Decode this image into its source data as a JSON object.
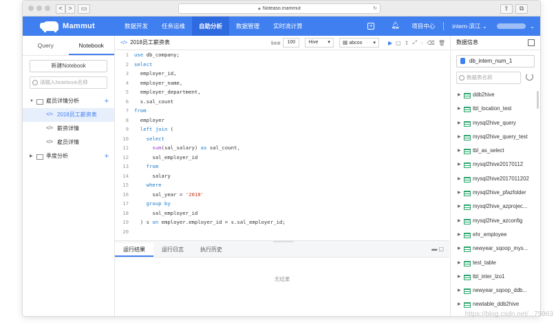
{
  "browser": {
    "url": "Noteaso.mammut",
    "back": "<",
    "forward": ">"
  },
  "app": {
    "logo_text": "Mammut",
    "menu": [
      "数据开发",
      "任务运维",
      "自助分析",
      "数据管理",
      "实时流计算"
    ],
    "active_menu": 2,
    "project_center": "项目中心",
    "project": "intern-滨江",
    "colors": {
      "nav": "#3f7ff0",
      "accent": "#3f7ff0"
    }
  },
  "left": {
    "tabs": [
      "Query",
      "Notebook"
    ],
    "new_notebook": "新建Notebook",
    "search_placeholder": "请输入Notebook名称",
    "tree": {
      "folder1": "雇员详情分析",
      "file1": "2018员工薪资表",
      "file2": "薪资详情",
      "file3": "雇员详情",
      "folder2": "季度分析"
    }
  },
  "editor": {
    "title": "2018员工薪资表",
    "limit_label": "limit",
    "limit_value": "100",
    "engine": "Hive",
    "queue": "abcoo",
    "lines": [
      "use db_company;",
      "select",
      "  employer_id,",
      "  employer_name,",
      "  employer_department,",
      "  s.sal_count",
      "from",
      "  employer",
      "  left join (",
      "    select",
      "      sum(sal_salary) as sal_count,",
      "      sal_employer_id",
      "    from",
      "      salary",
      "    where",
      "      sal_year = '2018'",
      "    group by",
      "      sal_employer_id",
      "  ) s on employer.employer_id = s.sal_employer_id;",
      ""
    ],
    "result_tabs": [
      "运行结果",
      "运行日志",
      "执行历史"
    ],
    "no_result": "无结果"
  },
  "right": {
    "title": "数据信息",
    "database": "db_intern_num_1",
    "search_placeholder": "数据表名称",
    "tables": [
      "ddb2hive",
      "tbl_location_test",
      "mysql2hive_query",
      "mysql2hive_query_test",
      "tbl_as_select",
      "mysql2hive20170112",
      "mysql2hive2017011202",
      "mysql2hive_pfazfolder",
      "mysql2hive_azprojec...",
      "mysql2hive_azconfig",
      "ehr_employee",
      "newyear_sqoop_mys...",
      "test_table",
      "tbl_inter_lzo1",
      "newyear_sqoop_ddb...",
      "newtable_ddb2hive"
    ]
  },
  "watermark": "https://blog.csdn.net/...75963"
}
